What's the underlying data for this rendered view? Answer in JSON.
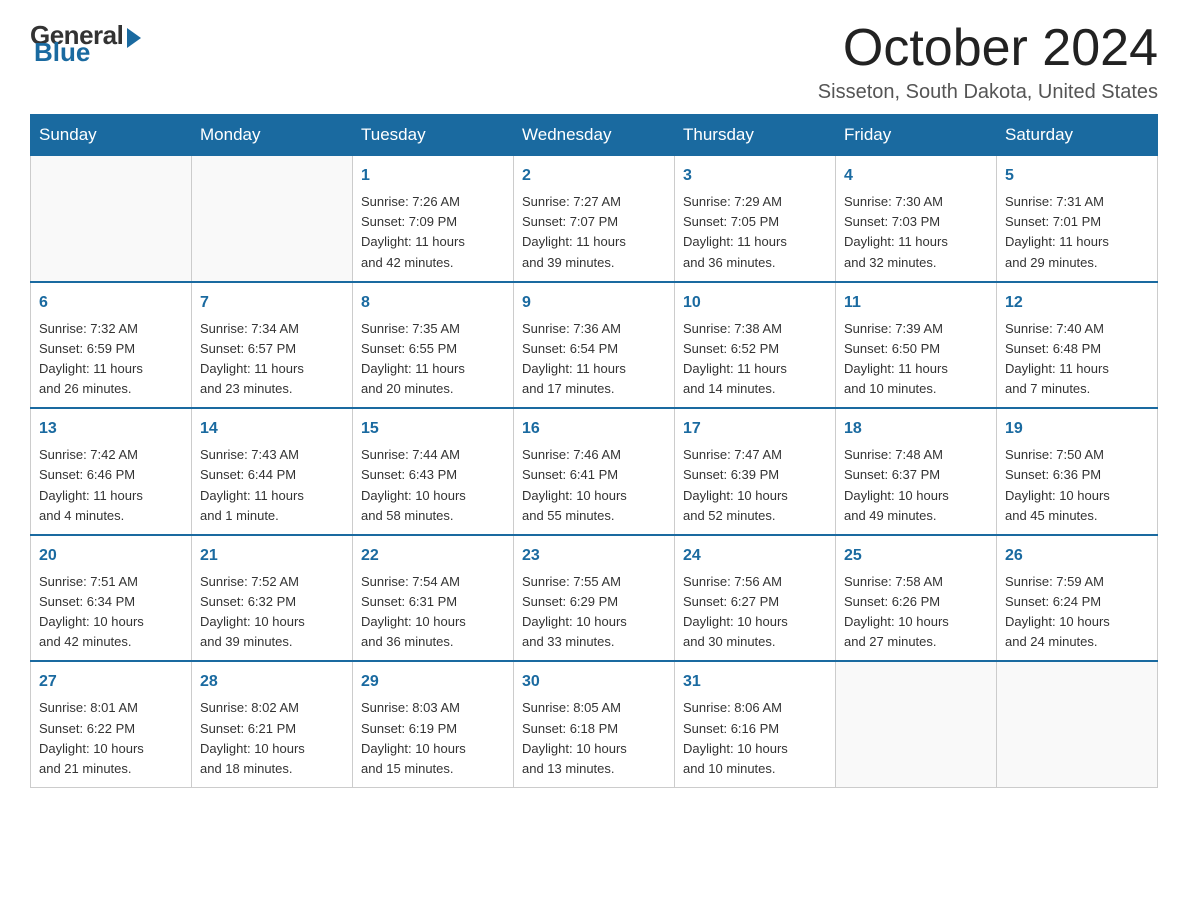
{
  "header": {
    "logo": {
      "general": "General",
      "blue": "Blue"
    },
    "title": "October 2024",
    "location": "Sisseton, South Dakota, United States"
  },
  "weekdays": [
    "Sunday",
    "Monday",
    "Tuesday",
    "Wednesday",
    "Thursday",
    "Friday",
    "Saturday"
  ],
  "weeks": [
    [
      {
        "day": "",
        "info": ""
      },
      {
        "day": "",
        "info": ""
      },
      {
        "day": "1",
        "info": "Sunrise: 7:26 AM\nSunset: 7:09 PM\nDaylight: 11 hours\nand 42 minutes."
      },
      {
        "day": "2",
        "info": "Sunrise: 7:27 AM\nSunset: 7:07 PM\nDaylight: 11 hours\nand 39 minutes."
      },
      {
        "day": "3",
        "info": "Sunrise: 7:29 AM\nSunset: 7:05 PM\nDaylight: 11 hours\nand 36 minutes."
      },
      {
        "day": "4",
        "info": "Sunrise: 7:30 AM\nSunset: 7:03 PM\nDaylight: 11 hours\nand 32 minutes."
      },
      {
        "day": "5",
        "info": "Sunrise: 7:31 AM\nSunset: 7:01 PM\nDaylight: 11 hours\nand 29 minutes."
      }
    ],
    [
      {
        "day": "6",
        "info": "Sunrise: 7:32 AM\nSunset: 6:59 PM\nDaylight: 11 hours\nand 26 minutes."
      },
      {
        "day": "7",
        "info": "Sunrise: 7:34 AM\nSunset: 6:57 PM\nDaylight: 11 hours\nand 23 minutes."
      },
      {
        "day": "8",
        "info": "Sunrise: 7:35 AM\nSunset: 6:55 PM\nDaylight: 11 hours\nand 20 minutes."
      },
      {
        "day": "9",
        "info": "Sunrise: 7:36 AM\nSunset: 6:54 PM\nDaylight: 11 hours\nand 17 minutes."
      },
      {
        "day": "10",
        "info": "Sunrise: 7:38 AM\nSunset: 6:52 PM\nDaylight: 11 hours\nand 14 minutes."
      },
      {
        "day": "11",
        "info": "Sunrise: 7:39 AM\nSunset: 6:50 PM\nDaylight: 11 hours\nand 10 minutes."
      },
      {
        "day": "12",
        "info": "Sunrise: 7:40 AM\nSunset: 6:48 PM\nDaylight: 11 hours\nand 7 minutes."
      }
    ],
    [
      {
        "day": "13",
        "info": "Sunrise: 7:42 AM\nSunset: 6:46 PM\nDaylight: 11 hours\nand 4 minutes."
      },
      {
        "day": "14",
        "info": "Sunrise: 7:43 AM\nSunset: 6:44 PM\nDaylight: 11 hours\nand 1 minute."
      },
      {
        "day": "15",
        "info": "Sunrise: 7:44 AM\nSunset: 6:43 PM\nDaylight: 10 hours\nand 58 minutes."
      },
      {
        "day": "16",
        "info": "Sunrise: 7:46 AM\nSunset: 6:41 PM\nDaylight: 10 hours\nand 55 minutes."
      },
      {
        "day": "17",
        "info": "Sunrise: 7:47 AM\nSunset: 6:39 PM\nDaylight: 10 hours\nand 52 minutes."
      },
      {
        "day": "18",
        "info": "Sunrise: 7:48 AM\nSunset: 6:37 PM\nDaylight: 10 hours\nand 49 minutes."
      },
      {
        "day": "19",
        "info": "Sunrise: 7:50 AM\nSunset: 6:36 PM\nDaylight: 10 hours\nand 45 minutes."
      }
    ],
    [
      {
        "day": "20",
        "info": "Sunrise: 7:51 AM\nSunset: 6:34 PM\nDaylight: 10 hours\nand 42 minutes."
      },
      {
        "day": "21",
        "info": "Sunrise: 7:52 AM\nSunset: 6:32 PM\nDaylight: 10 hours\nand 39 minutes."
      },
      {
        "day": "22",
        "info": "Sunrise: 7:54 AM\nSunset: 6:31 PM\nDaylight: 10 hours\nand 36 minutes."
      },
      {
        "day": "23",
        "info": "Sunrise: 7:55 AM\nSunset: 6:29 PM\nDaylight: 10 hours\nand 33 minutes."
      },
      {
        "day": "24",
        "info": "Sunrise: 7:56 AM\nSunset: 6:27 PM\nDaylight: 10 hours\nand 30 minutes."
      },
      {
        "day": "25",
        "info": "Sunrise: 7:58 AM\nSunset: 6:26 PM\nDaylight: 10 hours\nand 27 minutes."
      },
      {
        "day": "26",
        "info": "Sunrise: 7:59 AM\nSunset: 6:24 PM\nDaylight: 10 hours\nand 24 minutes."
      }
    ],
    [
      {
        "day": "27",
        "info": "Sunrise: 8:01 AM\nSunset: 6:22 PM\nDaylight: 10 hours\nand 21 minutes."
      },
      {
        "day": "28",
        "info": "Sunrise: 8:02 AM\nSunset: 6:21 PM\nDaylight: 10 hours\nand 18 minutes."
      },
      {
        "day": "29",
        "info": "Sunrise: 8:03 AM\nSunset: 6:19 PM\nDaylight: 10 hours\nand 15 minutes."
      },
      {
        "day": "30",
        "info": "Sunrise: 8:05 AM\nSunset: 6:18 PM\nDaylight: 10 hours\nand 13 minutes."
      },
      {
        "day": "31",
        "info": "Sunrise: 8:06 AM\nSunset: 6:16 PM\nDaylight: 10 hours\nand 10 minutes."
      },
      {
        "day": "",
        "info": ""
      },
      {
        "day": "",
        "info": ""
      }
    ]
  ]
}
